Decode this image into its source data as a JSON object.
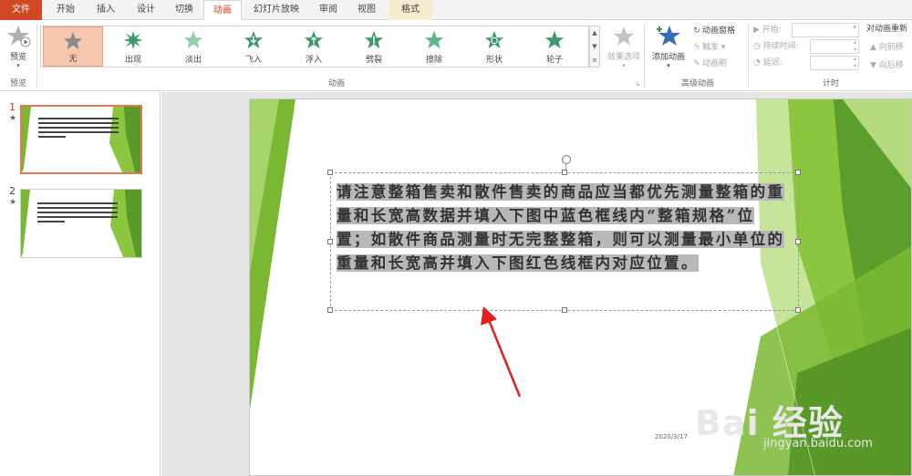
{
  "tabs": [
    {
      "label": "文件"
    },
    {
      "label": "开始"
    },
    {
      "label": "插入"
    },
    {
      "label": "设计"
    },
    {
      "label": "切换"
    },
    {
      "label": "动画"
    },
    {
      "label": "幻灯片放映"
    },
    {
      "label": "审阅"
    },
    {
      "label": "视图"
    },
    {
      "label": "格式"
    }
  ],
  "preview": {
    "label": "预览",
    "group_label": "预览"
  },
  "animations": {
    "group_label": "动画",
    "items": [
      {
        "label": "无",
        "selected": true
      },
      {
        "label": "出现"
      },
      {
        "label": "淡出"
      },
      {
        "label": "飞入"
      },
      {
        "label": "浮入"
      },
      {
        "label": "劈裂"
      },
      {
        "label": "擦除"
      },
      {
        "label": "形状"
      },
      {
        "label": "轮子"
      }
    ],
    "effect_options": "效果选项"
  },
  "advanced": {
    "group_label": "高级动画",
    "add_animation": "添加动画",
    "animation_pane": "动画窗格",
    "trigger": "触发",
    "animation_painter": "动画刷"
  },
  "timing": {
    "group_label": "计时",
    "start": "开始:",
    "duration": "持续时间:",
    "delay": "延迟:",
    "reorder_title": "对动画重新",
    "move_earlier": "向前移",
    "move_later": "向后移"
  },
  "slides": [
    {
      "number": "1",
      "star": "★"
    },
    {
      "number": "2",
      "star": "★"
    }
  ],
  "slide": {
    "text": "请注意整箱售卖和散件售卖的商品应当都优先测量整箱的重量和长宽高数据并填入下图中蓝色框线内“整箱规格”位置；如散件商品测量时无完整整箱，则可以测量最小单位的重量和长宽高并填入下图红色线框内对应位置。",
    "date": "2020/3/17"
  },
  "watermark": {
    "brand": "Bai 经验",
    "url": "jingyan.baidu.com"
  },
  "colors": {
    "file_tab": "#d24726",
    "accent": "#c43e1c",
    "selected_anim": "#f6c6ad",
    "star_green": "#3e9a6a",
    "slide_green": "#7ab833",
    "arrow_red": "#e02020"
  }
}
